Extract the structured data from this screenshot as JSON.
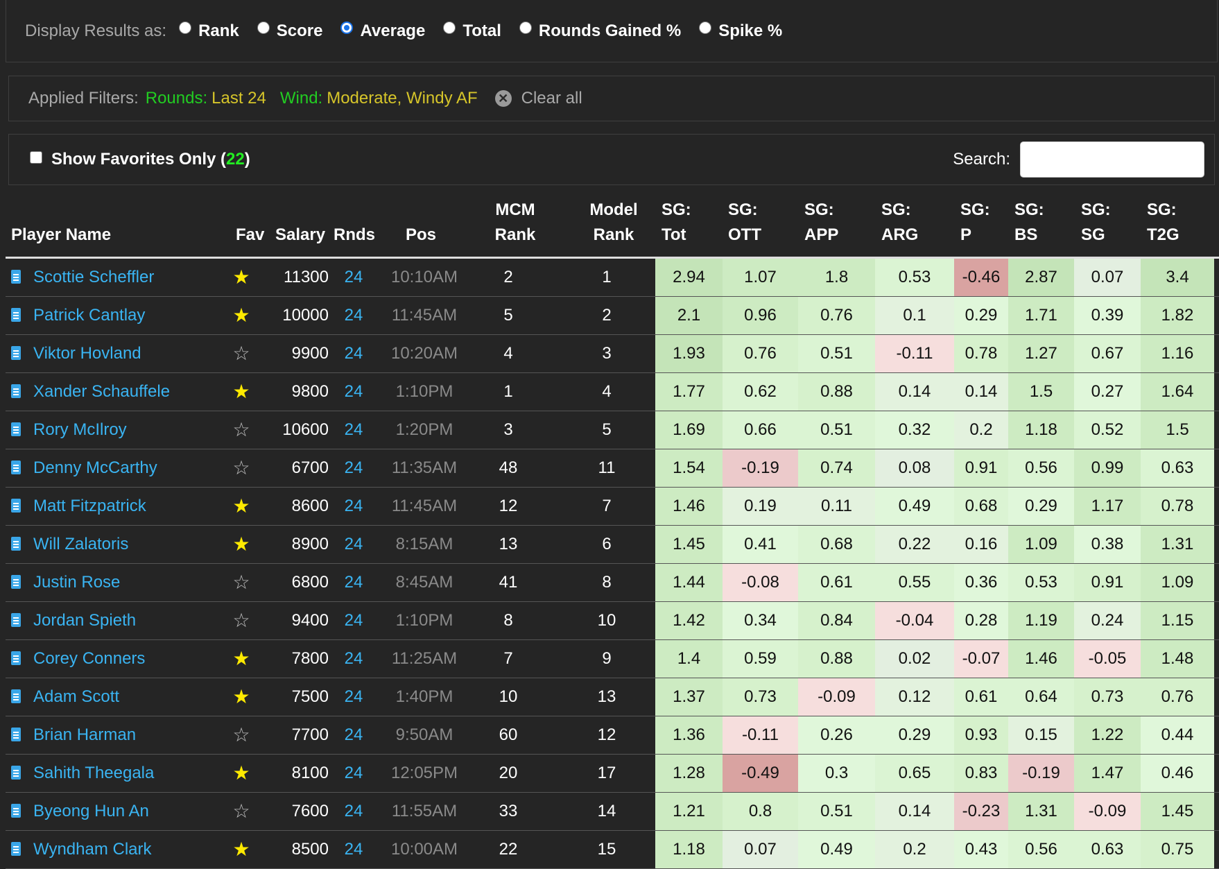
{
  "display": {
    "label": "Display Results as:",
    "options": [
      {
        "label": "Rank",
        "checked": false
      },
      {
        "label": "Score",
        "checked": false
      },
      {
        "label": "Average",
        "checked": true
      },
      {
        "label": "Total",
        "checked": false
      },
      {
        "label": "Rounds Gained %",
        "checked": false
      },
      {
        "label": "Spike %",
        "checked": false
      }
    ]
  },
  "filters": {
    "label": "Applied Filters:",
    "rounds_key": "Rounds:",
    "rounds_value": "Last 24",
    "wind_key": "Wind:",
    "wind_value": "Moderate, Windy AF",
    "clear_label": "Clear all"
  },
  "favorites": {
    "label_prefix": "Show Favorites Only (",
    "count": "22",
    "label_suffix": ")"
  },
  "search": {
    "label": "Search:",
    "value": ""
  },
  "columns": {
    "player": "Player Name",
    "fav": "Fav",
    "salary": "Salary",
    "rnds": "Rnds",
    "pos": "Pos",
    "mcm_1": "MCM",
    "mcm_2": "Rank",
    "model_1": "Model",
    "model_2": "Rank",
    "sg_tot_1": "SG:",
    "sg_tot_2": "Tot",
    "sg_ott_1": "SG:",
    "sg_ott_2": "OTT",
    "sg_app_1": "SG:",
    "sg_app_2": "APP",
    "sg_arg_1": "SG:",
    "sg_arg_2": "ARG",
    "sg_p_1": "SG:",
    "sg_p_2": "P",
    "sg_bs_1": "SG:",
    "sg_bs_2": "BS",
    "sg_sg_1": "SG:",
    "sg_sg_2": "SG",
    "sg_t2g_1": "SG:",
    "sg_t2g_2": "T2G"
  },
  "rows": [
    {
      "name": "Scottie Scheffler",
      "fav": true,
      "salary": "11300",
      "rnds": "24",
      "pos": "10:10AM",
      "mcm": "2",
      "model": "1",
      "sg": [
        "2.94",
        "1.07",
        "1.8",
        "0.53",
        "-0.46",
        "2.87",
        "0.07",
        "3.4"
      ]
    },
    {
      "name": "Patrick Cantlay",
      "fav": true,
      "salary": "10000",
      "rnds": "24",
      "pos": "11:45AM",
      "mcm": "5",
      "model": "2",
      "sg": [
        "2.1",
        "0.96",
        "0.76",
        "0.1",
        "0.29",
        "1.71",
        "0.39",
        "1.82"
      ]
    },
    {
      "name": "Viktor Hovland",
      "fav": false,
      "salary": "9900",
      "rnds": "24",
      "pos": "10:20AM",
      "mcm": "4",
      "model": "3",
      "sg": [
        "1.93",
        "0.76",
        "0.51",
        "-0.11",
        "0.78",
        "1.27",
        "0.67",
        "1.16"
      ]
    },
    {
      "name": "Xander Schauffele",
      "fav": true,
      "salary": "9800",
      "rnds": "24",
      "pos": "1:10PM",
      "mcm": "1",
      "model": "4",
      "sg": [
        "1.77",
        "0.62",
        "0.88",
        "0.14",
        "0.14",
        "1.5",
        "0.27",
        "1.64"
      ]
    },
    {
      "name": "Rory McIlroy",
      "fav": false,
      "salary": "10600",
      "rnds": "24",
      "pos": "1:20PM",
      "mcm": "3",
      "model": "5",
      "sg": [
        "1.69",
        "0.66",
        "0.51",
        "0.32",
        "0.2",
        "1.18",
        "0.52",
        "1.5"
      ]
    },
    {
      "name": "Denny McCarthy",
      "fav": false,
      "salary": "6700",
      "rnds": "24",
      "pos": "11:35AM",
      "mcm": "48",
      "model": "11",
      "sg": [
        "1.54",
        "-0.19",
        "0.74",
        "0.08",
        "0.91",
        "0.56",
        "0.99",
        "0.63"
      ]
    },
    {
      "name": "Matt Fitzpatrick",
      "fav": true,
      "salary": "8600",
      "rnds": "24",
      "pos": "11:45AM",
      "mcm": "12",
      "model": "7",
      "sg": [
        "1.46",
        "0.19",
        "0.11",
        "0.49",
        "0.68",
        "0.29",
        "1.17",
        "0.78"
      ]
    },
    {
      "name": "Will Zalatoris",
      "fav": true,
      "salary": "8900",
      "rnds": "24",
      "pos": "8:15AM",
      "mcm": "13",
      "model": "6",
      "sg": [
        "1.45",
        "0.41",
        "0.68",
        "0.22",
        "0.16",
        "1.09",
        "0.38",
        "1.31"
      ]
    },
    {
      "name": "Justin Rose",
      "fav": false,
      "salary": "6800",
      "rnds": "24",
      "pos": "8:45AM",
      "mcm": "41",
      "model": "8",
      "sg": [
        "1.44",
        "-0.08",
        "0.61",
        "0.55",
        "0.36",
        "0.53",
        "0.91",
        "1.09"
      ]
    },
    {
      "name": "Jordan Spieth",
      "fav": false,
      "salary": "9400",
      "rnds": "24",
      "pos": "1:10PM",
      "mcm": "8",
      "model": "10",
      "sg": [
        "1.42",
        "0.34",
        "0.84",
        "-0.04",
        "0.28",
        "1.19",
        "0.24",
        "1.15"
      ]
    },
    {
      "name": "Corey Conners",
      "fav": true,
      "salary": "7800",
      "rnds": "24",
      "pos": "11:25AM",
      "mcm": "7",
      "model": "9",
      "sg": [
        "1.4",
        "0.59",
        "0.88",
        "0.02",
        "-0.07",
        "1.46",
        "-0.05",
        "1.48"
      ]
    },
    {
      "name": "Adam Scott",
      "fav": true,
      "salary": "7500",
      "rnds": "24",
      "pos": "1:40PM",
      "mcm": "10",
      "model": "13",
      "sg": [
        "1.37",
        "0.73",
        "-0.09",
        "0.12",
        "0.61",
        "0.64",
        "0.73",
        "0.76"
      ]
    },
    {
      "name": "Brian Harman",
      "fav": false,
      "salary": "7700",
      "rnds": "24",
      "pos": "9:50AM",
      "mcm": "60",
      "model": "12",
      "sg": [
        "1.36",
        "-0.11",
        "0.26",
        "0.29",
        "0.93",
        "0.15",
        "1.22",
        "0.44"
      ]
    },
    {
      "name": "Sahith Theegala",
      "fav": true,
      "salary": "8100",
      "rnds": "24",
      "pos": "12:05PM",
      "mcm": "20",
      "model": "17",
      "sg": [
        "1.28",
        "-0.49",
        "0.3",
        "0.65",
        "0.83",
        "-0.19",
        "1.47",
        "0.46"
      ]
    },
    {
      "name": "Byeong Hun An",
      "fav": false,
      "salary": "7600",
      "rnds": "24",
      "pos": "11:55AM",
      "mcm": "33",
      "model": "14",
      "sg": [
        "1.21",
        "0.8",
        "0.51",
        "0.14",
        "-0.23",
        "1.31",
        "-0.09",
        "1.45"
      ]
    },
    {
      "name": "Wyndham Clark",
      "fav": true,
      "salary": "8500",
      "rnds": "24",
      "pos": "10:00AM",
      "mcm": "22",
      "model": "15",
      "sg": [
        "1.18",
        "0.07",
        "0.49",
        "0.2",
        "0.43",
        "0.56",
        "0.63",
        "0.75"
      ]
    }
  ]
}
